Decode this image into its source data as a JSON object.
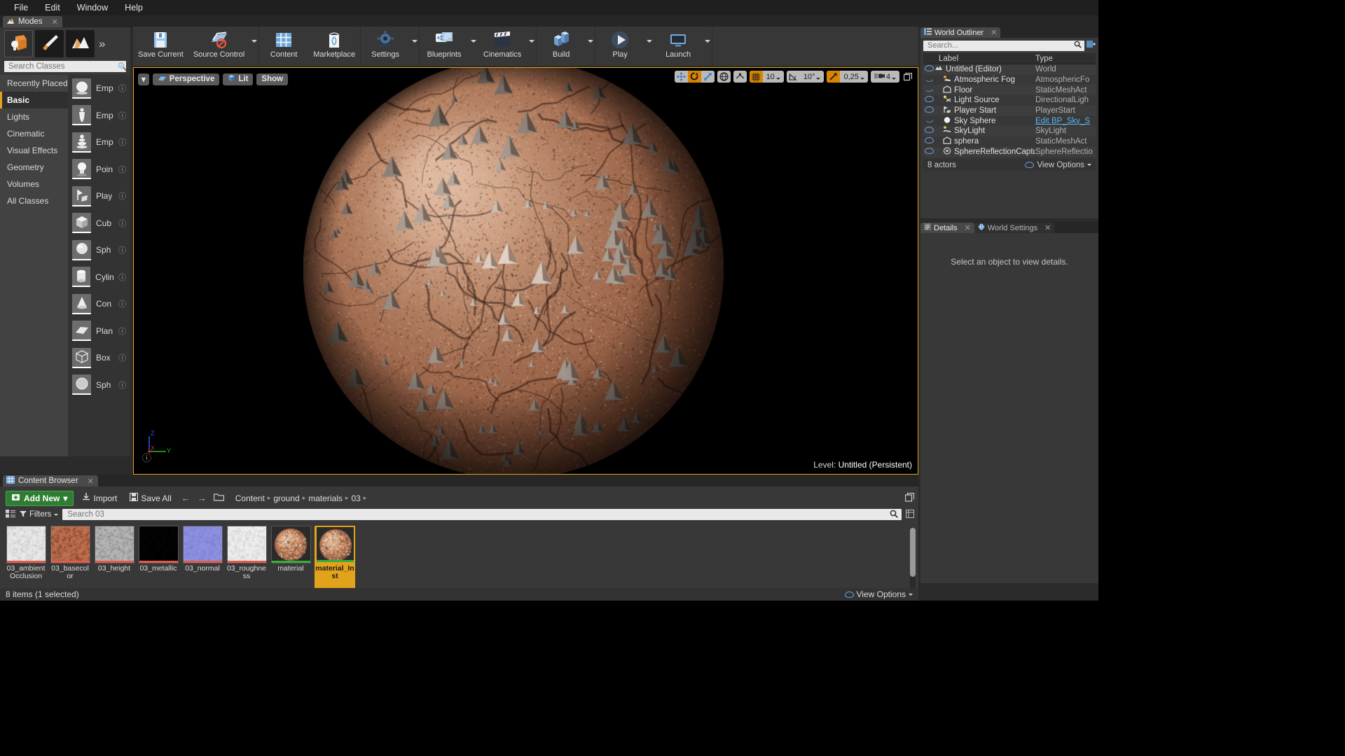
{
  "menu": {
    "items": [
      "File",
      "Edit",
      "Window",
      "Help"
    ]
  },
  "modes_panel": {
    "tab_label": "Modes",
    "tab_icon": "modes-icon",
    "mode_buttons": [
      {
        "name": "place-mode",
        "icon": "place-cube-icon",
        "selected": true
      },
      {
        "name": "paint-mode",
        "icon": "paintbrush-icon",
        "selected": false
      },
      {
        "name": "landscape-mode",
        "icon": "landscape-icon",
        "selected": false
      }
    ],
    "expand_glyph": "»",
    "search_placeholder": "Search Classes",
    "search_value": "",
    "categories": [
      {
        "label": "Recently Placed",
        "selected": false
      },
      {
        "label": "Basic",
        "selected": true
      },
      {
        "label": "Lights",
        "selected": false
      },
      {
        "label": "Cinematic",
        "selected": false
      },
      {
        "label": "Visual Effects",
        "selected": false
      },
      {
        "label": "Geometry",
        "selected": false
      },
      {
        "label": "Volumes",
        "selected": false
      },
      {
        "label": "All Classes",
        "selected": false
      }
    ],
    "items": [
      {
        "label": "Emp",
        "icon": "empty-actor-icon"
      },
      {
        "label": "Emp",
        "icon": "empty-character-icon"
      },
      {
        "label": "Emp",
        "icon": "empty-pawn-icon"
      },
      {
        "label": "Poin",
        "icon": "point-light-icon"
      },
      {
        "label": "Play",
        "icon": "player-start-icon"
      },
      {
        "label": "Cub",
        "icon": "cube-icon"
      },
      {
        "label": "Sph",
        "icon": "sphere-icon"
      },
      {
        "label": "Cylin",
        "icon": "cylinder-icon"
      },
      {
        "label": "Con",
        "icon": "cone-icon"
      },
      {
        "label": "Plan",
        "icon": "plane-icon"
      },
      {
        "label": "Box",
        "icon": "box-trigger-icon"
      },
      {
        "label": "Sph",
        "icon": "sphere-trigger-icon"
      }
    ],
    "help_glyph": "?"
  },
  "toolbar": {
    "groups": [
      {
        "buttons": [
          {
            "label": "Save Current",
            "icon": "save-icon",
            "caret": false
          },
          {
            "label": "Source Control",
            "icon": "source-control-icon",
            "caret": true
          }
        ]
      },
      {
        "buttons": [
          {
            "label": "Content",
            "icon": "content-icon",
            "caret": false
          },
          {
            "label": "Marketplace",
            "icon": "marketplace-icon",
            "caret": false
          }
        ]
      },
      {
        "buttons": [
          {
            "label": "Settings",
            "icon": "settings-gear-icon",
            "caret": true
          }
        ]
      },
      {
        "buttons": [
          {
            "label": "Blueprints",
            "icon": "blueprints-icon",
            "caret": true
          },
          {
            "label": "Cinematics",
            "icon": "cinematics-clapper-icon",
            "caret": true
          }
        ]
      },
      {
        "buttons": [
          {
            "label": "Build",
            "icon": "build-icon",
            "caret": true
          }
        ]
      },
      {
        "buttons": [
          {
            "label": "Play",
            "icon": "play-icon",
            "caret": true
          },
          {
            "label": "Launch",
            "icon": "launch-icon",
            "caret": true
          }
        ]
      }
    ]
  },
  "viewport": {
    "menu_caret": "▾",
    "perspective_label": "Perspective",
    "perspective_icon": "camera-icon",
    "view_mode_label": "Lit",
    "view_mode_icon": "lit-cube-icon",
    "show_label": "Show",
    "transform_tools": [
      {
        "name": "translate-tool",
        "icon": "move-icon",
        "active": false
      },
      {
        "name": "rotate-tool",
        "icon": "rotate-icon",
        "active": true
      },
      {
        "name": "scale-tool",
        "icon": "scale-icon",
        "active": false
      }
    ],
    "coordinate_system": {
      "name": "world-coordinate-toggle",
      "icon": "globe-icon"
    },
    "surface_snap": {
      "name": "surface-snap-toggle",
      "icon": "surface-snap-icon"
    },
    "grid_snap": {
      "name": "grid-snap-toggle",
      "icon": "grid-icon",
      "active": true,
      "value": "10"
    },
    "rotation_snap": {
      "name": "rotation-snap-toggle",
      "icon": "angle-icon",
      "active": false,
      "value": "10°"
    },
    "scale_snap": {
      "name": "scale-snap-toggle",
      "icon": "scale-snap-icon",
      "active": true,
      "value": "0,25"
    },
    "camera_speed": {
      "name": "camera-speed",
      "icon": "camera-speed-icon",
      "value": "4"
    },
    "maximize_icon": "maximize-viewport-icon",
    "axis_labels": {
      "z": "Z",
      "x": "X",
      "y": "Y"
    },
    "help_glyph": "?",
    "level_prefix": "Level:",
    "level_name": "Untitled (Persistent)"
  },
  "world_outliner": {
    "tab_label": "World Outliner",
    "tab_icon": "outliner-icon",
    "search_placeholder": "Search...",
    "search_value": "",
    "search_icon": "search-icon",
    "add_icon": "add-column-icon",
    "columns": [
      "Label",
      "Type"
    ],
    "rows": [
      {
        "label": "Untitled (Editor)",
        "type": "World",
        "visible": true,
        "icon": "world-icon",
        "indent": 0,
        "type_is_link": false
      },
      {
        "label": "Atmospheric Fog",
        "type": "AtmosphericFo",
        "visible": false,
        "icon": "fog-icon",
        "indent": 1,
        "type_is_link": false
      },
      {
        "label": "Floor",
        "type": "StaticMeshAct",
        "visible": false,
        "icon": "mesh-icon",
        "indent": 1,
        "type_is_link": false
      },
      {
        "label": "Light Source",
        "type": "DirectionalLigh",
        "visible": true,
        "icon": "light-icon",
        "indent": 1,
        "type_is_link": false
      },
      {
        "label": "Player Start",
        "type": "PlayerStart",
        "visible": true,
        "icon": "player-start-icon",
        "indent": 1,
        "type_is_link": false
      },
      {
        "label": "Sky Sphere",
        "type": "Edit BP_Sky_S",
        "visible": false,
        "icon": "sphere-icon",
        "indent": 1,
        "type_is_link": true
      },
      {
        "label": "SkyLight",
        "type": "SkyLight",
        "visible": true,
        "icon": "skylight-icon",
        "indent": 1,
        "type_is_link": false
      },
      {
        "label": "sphera",
        "type": "StaticMeshAct",
        "visible": true,
        "icon": "mesh-icon",
        "indent": 1,
        "type_is_link": false
      },
      {
        "label": "SphereReflectionCapture",
        "type": "SphereReflectio",
        "visible": true,
        "icon": "reflection-icon",
        "indent": 1,
        "type_is_link": false
      }
    ],
    "actor_count": "8 actors",
    "view_options_label": "View Options",
    "view_options_icon": "eye-icon"
  },
  "details_panel": {
    "tabs": [
      {
        "label": "Details",
        "icon": "details-icon",
        "active": true,
        "closable": true
      },
      {
        "label": "World Settings",
        "icon": "world-settings-icon",
        "active": false,
        "closable": true
      }
    ],
    "empty_message": "Select an object to view details."
  },
  "content_browser": {
    "tab_label": "Content Browser",
    "tab_icon": "content-browser-icon",
    "add_new_label": "Add New",
    "add_new_icon": "add-new-icon",
    "add_new_caret": "▾",
    "import_label": "Import",
    "import_icon": "import-icon",
    "save_all_label": "Save All",
    "save_all_icon": "save-all-icon",
    "back_icon": "back-arrow-icon",
    "forward_icon": "forward-arrow-icon",
    "folder_icon": "folder-icon",
    "breadcrumbs": [
      "Content",
      "ground",
      "materials",
      "03"
    ],
    "breadcrumb_sep": "▸",
    "lock_icon": "dock-icon",
    "filters_label": "Filters",
    "filters_icon": "filter-icon",
    "view_type_icon": "view-type-icon",
    "search_placeholder": "Search 03",
    "search_value": "",
    "search_icon": "search-icon",
    "settings_icon": "cb-settings-icon",
    "assets": [
      {
        "name": "03_ambientOcclusion",
        "kind": "texture",
        "selected": false,
        "bar": "#e35b4b",
        "c1": "#e9e9e9",
        "c2": "#cfcfcf"
      },
      {
        "name": "03_basecolor",
        "kind": "texture",
        "selected": false,
        "bar": "#e35b4b",
        "c1": "#c0714f",
        "c2": "#8a4a32"
      },
      {
        "name": "03_height",
        "kind": "texture",
        "selected": false,
        "bar": "#e35b4b",
        "c1": "#b6b6b6",
        "c2": "#8e8e8e"
      },
      {
        "name": "03_metallic",
        "kind": "texture",
        "selected": false,
        "bar": "#e35b4b",
        "c1": "#050505",
        "c2": "#000000"
      },
      {
        "name": "03_normal",
        "kind": "texture",
        "selected": false,
        "bar": "#e35b4b",
        "c1": "#8f92e0",
        "c2": "#7d82d6"
      },
      {
        "name": "03_roughness",
        "kind": "texture",
        "selected": false,
        "bar": "#e35b4b",
        "c1": "#efefef",
        "c2": "#d6d6d6"
      },
      {
        "name": "material",
        "kind": "material",
        "selected": false,
        "bar": "#33b13a",
        "c1": "#c98a63",
        "c2": "#8a5235"
      },
      {
        "name": "material_Inst",
        "kind": "material-instance",
        "selected": true,
        "bar": "#33b13a",
        "c1": "#c98a63",
        "c2": "#8a5235"
      }
    ],
    "status": "8 items (1 selected)",
    "view_options_label": "View Options",
    "view_options_icon": "eye-icon"
  },
  "colors": {
    "accent_orange": "#e3a21c",
    "panel_bg": "#383838",
    "dark_bg": "#262626",
    "link_blue": "#59b7ee",
    "green_button": "#2f7d32"
  }
}
